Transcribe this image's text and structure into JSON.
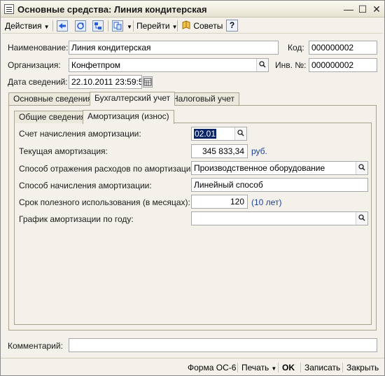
{
  "window": {
    "title": "Основные средства: Линия кондитерская"
  },
  "toolbar": {
    "actions": "Действия",
    "goto": "Перейти",
    "tips": "Советы",
    "help": "?"
  },
  "header": {
    "name_label": "Наименование:",
    "name_value": "Линия кондитерская",
    "code_label": "Код:",
    "code_value": "000000002",
    "org_label": "Организация:",
    "org_value": "Конфетпром",
    "inv_label": "Инв. №:",
    "inv_value": "000000002",
    "date_label": "Дата сведений:",
    "date_value": "22.10.2011 23:59:59"
  },
  "tabs": [
    "Основные сведения",
    "Бухгалтерский учет",
    "Налоговый учет"
  ],
  "subtabs": [
    "Общие сведения",
    "Амортизация (износ)"
  ],
  "depreciation": {
    "account_label": "Счет начисления амортизации:",
    "account_value": "02.01",
    "current_label": "Текущая амортизация:",
    "current_value": "345 833,34",
    "current_unit": "руб.",
    "expense_label": "Способ отражения расходов по амортизации:",
    "expense_value": "Производственное оборудование",
    "method_label": "Способ начисления амортизации:",
    "method_value": "Линейный способ",
    "term_label": "Срок полезного использования (в месяцах):",
    "term_value": "120",
    "term_note": "(10 лет)",
    "schedule_label": "График амортизации по году:",
    "schedule_value": ""
  },
  "footer": {
    "comment_label": "Комментарий:",
    "comment_value": ""
  },
  "bottombar": {
    "form": "Форма ОС-6",
    "print": "Печать",
    "ok": "OK",
    "save": "Записать",
    "close": "Закрыть"
  }
}
